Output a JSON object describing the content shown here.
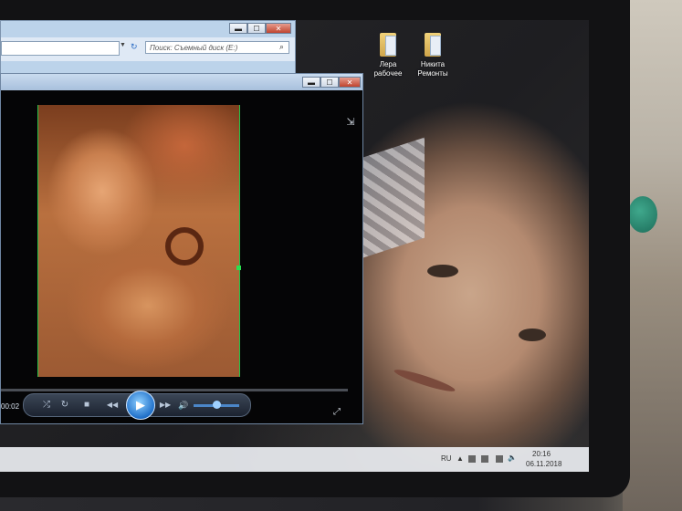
{
  "desktop_icons": [
    {
      "label_line1": "Лера",
      "label_line2": "рабочее",
      "icon": "folder-icon"
    },
    {
      "label_line1": "Никита",
      "label_line2": "Ремонты",
      "icon": "folder-icon"
    }
  ],
  "explorer": {
    "search_placeholder": "Поиск: Съемный диск (E:)",
    "buttons": {
      "minimize": "▬",
      "maximize": "☐",
      "close": "✕"
    }
  },
  "player": {
    "buttons": {
      "minimize": "▬",
      "maximize": "☐",
      "close": "✕"
    },
    "time_elapsed": "00:02",
    "controls": {
      "shuffle": "⤮",
      "repeat": "↻",
      "stop": "■",
      "previous": "◀◀",
      "play": "▶",
      "next": "▶▶",
      "volume": "🔊"
    },
    "switch_view_glyph": "⇲",
    "fullscreen_glyph": "⤢",
    "volume_level": 0.5
  },
  "taskbar": {
    "language": "RU",
    "clock_time": "20:16",
    "clock_date": "06.11.2018"
  }
}
